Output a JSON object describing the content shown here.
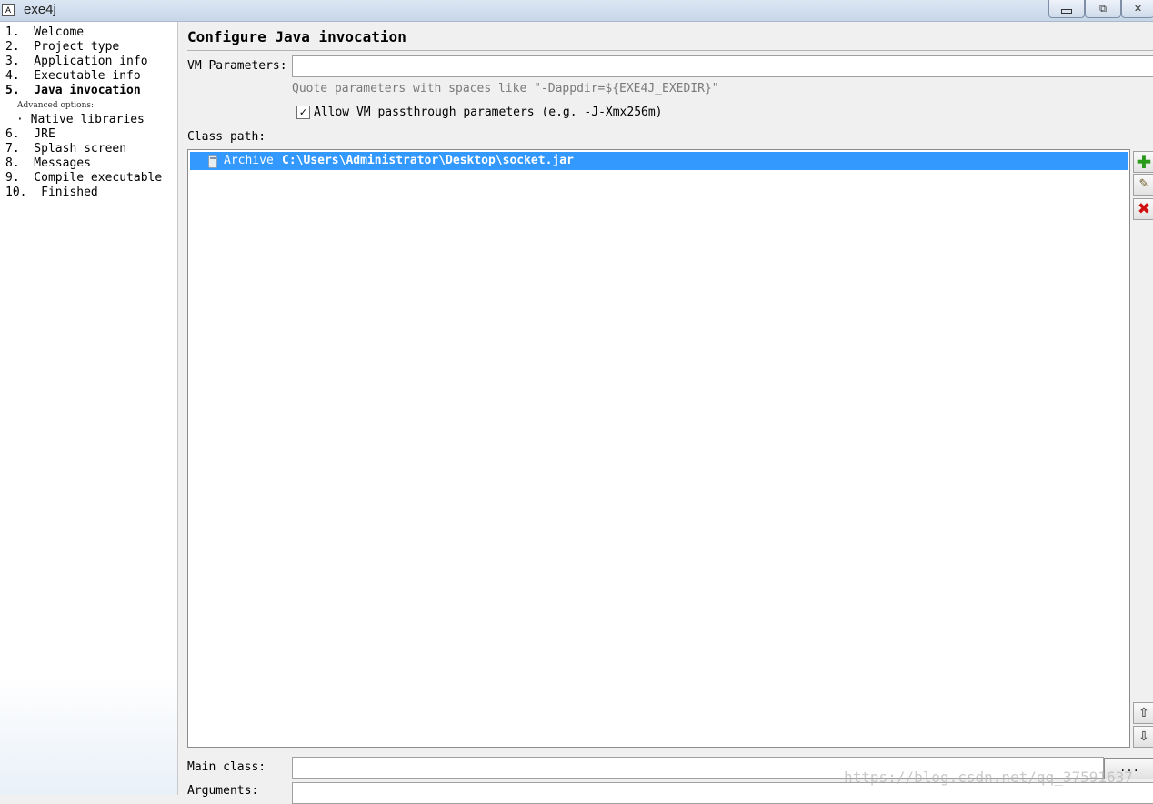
{
  "window": {
    "app_icon_text": "A",
    "title": "exe4j",
    "minimize_label": "",
    "maximize_label": "⧉",
    "close_label": "✕"
  },
  "sidebar": {
    "steps": [
      {
        "label": "1.  Welcome"
      },
      {
        "label": "2.  Project type"
      },
      {
        "label": "3.  Application info"
      },
      {
        "label": "4.  Executable info"
      },
      {
        "label": "5.  Java invocation"
      },
      {
        "label": "6.  JRE"
      },
      {
        "label": "7.  Splash screen"
      },
      {
        "label": "8.  Messages"
      },
      {
        "label": "9.  Compile executable"
      },
      {
        "label": "10.  Finished"
      }
    ],
    "advanced_label": "Advanced options:",
    "advanced_items": [
      {
        "label": "· Native libraries"
      }
    ]
  },
  "main": {
    "title": "Configure Java invocation",
    "vm_params_label": "VM Parameters:",
    "vm_params_value": "",
    "vm_hint": "Quote parameters with spaces like \"-Dappdir=${EXE4J_EXEDIR}\"",
    "passthrough_checked": "✓",
    "passthrough_label": "Allow VM passthrough parameters (e.g. -J-Xmx256m)",
    "classpath_label": "Class path:",
    "classpath_entries": [
      {
        "type": "Archive",
        "path": "C:\\Users\\Administrator\\Desktop\\socket.jar"
      }
    ],
    "buttons": {
      "add": "✚",
      "edit": "✎",
      "remove": "✖",
      "up": "⇧",
      "down": "⇩"
    },
    "main_class_label": "Main class:",
    "main_class_value": "",
    "browse_label": "...",
    "arguments_label": "Arguments:"
  },
  "watermark": "https://blog.csdn.net/qq_37591637"
}
